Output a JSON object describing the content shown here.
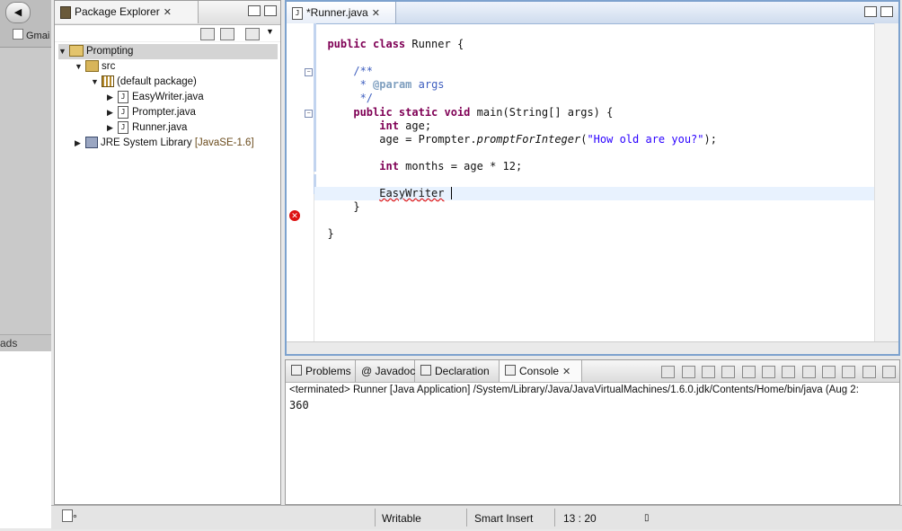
{
  "background_app": {
    "tab_label": "Gmai",
    "side_label": "ads"
  },
  "package_explorer": {
    "title": "Package Explorer",
    "tree": [
      {
        "label": "Prompting",
        "level": 0,
        "expanded": true,
        "icon": "project-icon"
      },
      {
        "label": "src",
        "level": 1,
        "expanded": true,
        "icon": "source-folder-icon"
      },
      {
        "label": "(default package)",
        "level": 2,
        "expanded": true,
        "icon": "package-icon"
      },
      {
        "label": "EasyWriter.java",
        "level": 3,
        "expanded": false,
        "icon": "java-file-icon"
      },
      {
        "label": "Prompter.java",
        "level": 3,
        "expanded": false,
        "icon": "java-file-icon"
      },
      {
        "label": "Runner.java",
        "level": 3,
        "expanded": false,
        "icon": "java-file-icon"
      },
      {
        "label": "JRE System Library",
        "suffix": "[JavaSE-1.6]",
        "level": 1,
        "expanded": false,
        "icon": "library-icon"
      }
    ]
  },
  "editor": {
    "tab_label": "*Runner.java",
    "lines": {
      "l1_kw": "public class",
      "l1_rest": " Runner {",
      "l3": "/**",
      "l4_star": " * ",
      "l4_tag": "@param",
      "l4_rest": " args",
      "l5": " */",
      "l6_kw": "public static void",
      "l6_rest": " main(String[] args) {",
      "l7_kw": "int",
      "l7_rest": " age;",
      "l8_a": "age = Prompter.",
      "l8_method": "promptForInteger",
      "l8_b": "(",
      "l8_str": "\"How old are you?\"",
      "l8_c": ");",
      "l10_kw": "int",
      "l10_rest": " months = age * 12;",
      "l12_err": "EasyWriter",
      "l13": "}",
      "l15": "}"
    }
  },
  "console": {
    "tabs": [
      "Problems",
      "Javadoc",
      "Declaration",
      "Console"
    ],
    "active_tab": "Console",
    "status": "<terminated> Runner [Java Application] /System/Library/Java/JavaVirtualMachines/1.6.0.jdk/Contents/Home/bin/java (Aug 2:",
    "output": "360"
  },
  "statusbar": {
    "writable": "Writable",
    "insert_mode": "Smart Insert",
    "position": "13 : 20"
  }
}
